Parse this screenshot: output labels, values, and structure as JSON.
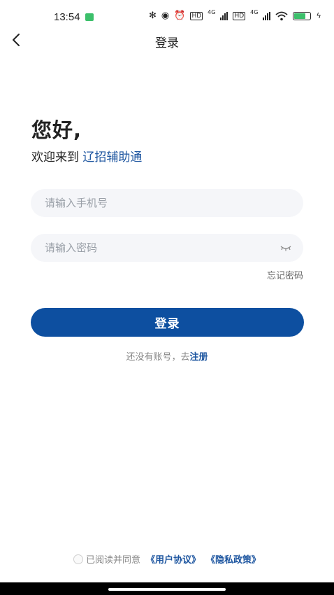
{
  "status_bar": {
    "time": "13:54",
    "network_label_1": "4G",
    "network_label_2": "4G",
    "battery_level": 0.7
  },
  "nav": {
    "title": "登录"
  },
  "greeting": {
    "title": "您好,",
    "welcome_prefix": "欢迎来到",
    "brand_name": "辽招辅助通"
  },
  "form": {
    "phone_placeholder": "请输入手机号",
    "phone_value": "",
    "password_placeholder": "请输入密码",
    "password_value": "",
    "forgot_label": "忘记密码",
    "login_label": "登录"
  },
  "register": {
    "prompt": "还没有账号，去",
    "link_label": "注册"
  },
  "agreement": {
    "prefix": "已阅读并同意",
    "user_agreement": "《用户协议》",
    "privacy_policy": "《隐私政策》"
  },
  "colors": {
    "primary": "#0d4fa0",
    "link": "#1e56a0",
    "input_bg": "#f5f6f9"
  }
}
